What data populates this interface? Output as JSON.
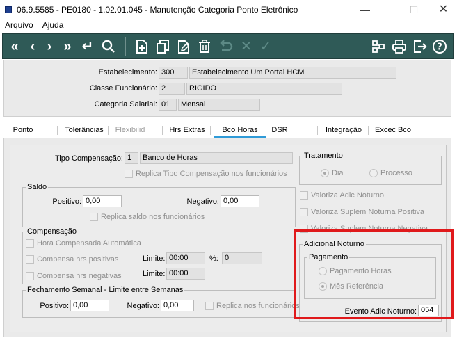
{
  "window": {
    "title": "06.9.5585 - PE0180 - 1.02.01.045 - Manutenção Categoria Ponto Eletrônico",
    "minimize": "—",
    "maximize": "☐",
    "close": "✕"
  },
  "menu": {
    "items": [
      {
        "label": "Arquivo"
      },
      {
        "label": "Ajuda"
      }
    ]
  },
  "toolbar": {
    "buttons": [
      {
        "icon": "first-record-icon",
        "glyph": "«"
      },
      {
        "icon": "previous-record-icon",
        "glyph": "‹"
      },
      {
        "icon": "next-record-icon",
        "glyph": "›"
      },
      {
        "icon": "last-record-icon",
        "glyph": "»"
      },
      {
        "icon": "goto-icon",
        "glyph": "↵"
      },
      {
        "icon": "search-icon",
        "glyph": "⌕"
      },
      {
        "icon": "add-icon",
        "glyph": ""
      },
      {
        "icon": "copy-icon",
        "glyph": ""
      },
      {
        "icon": "edit-icon",
        "glyph": ""
      },
      {
        "icon": "delete-icon",
        "glyph": ""
      },
      {
        "icon": "undo-icon",
        "glyph": ""
      },
      {
        "icon": "cancel-icon",
        "glyph": "✕"
      },
      {
        "icon": "confirm-icon",
        "glyph": "✓"
      },
      {
        "icon": "query-icon",
        "glyph": ""
      },
      {
        "icon": "print-icon",
        "glyph": ""
      },
      {
        "icon": "exit-icon",
        "glyph": ""
      },
      {
        "icon": "help-icon",
        "glyph": "?"
      }
    ]
  },
  "header": {
    "estabelecimento": {
      "label": "Estabelecimento:",
      "code": "300",
      "name": "Estabelecimento Um Portal HCM"
    },
    "classe": {
      "label": "Classe Funcionário:",
      "code": "2",
      "name": "RIGIDO"
    },
    "categoria": {
      "label": "Categoria Salarial:",
      "code": "01",
      "name": "Mensal"
    }
  },
  "tabs": [
    {
      "label": "Ponto",
      "state": "normal"
    },
    {
      "label": "Tolerâncias",
      "state": "normal"
    },
    {
      "label": "Flexibilid",
      "state": "disabled"
    },
    {
      "label": "Hrs Extras",
      "state": "normal"
    },
    {
      "label": "Bco Horas",
      "state": "active"
    },
    {
      "label": "DSR",
      "state": "normal"
    },
    {
      "label": "Integração",
      "state": "normal"
    },
    {
      "label": "Excec Bco",
      "state": "normal"
    }
  ],
  "bco_horas": {
    "tipo_compensacao": {
      "label": "Tipo Compensação:",
      "code": "1",
      "name": "Banco de Horas"
    },
    "replica_tipo": "Replica Tipo Compensação nos funcionários",
    "saldo": {
      "title": "Saldo",
      "positivo_label": "Positivo:",
      "positivo": "0,00",
      "negativo_label": "Negativo:",
      "negativo": "0,00",
      "replica": "Replica saldo nos funcionários"
    },
    "compensacao": {
      "title": "Compensação",
      "hora_auto": "Hora Compensada Automática",
      "hrs_positivas": "Compensa hrs positivas",
      "hrs_negativas": "Compensa hrs negativas",
      "limite_label": "Limite:",
      "limite1": "00:00",
      "pct_label": "%:",
      "pct": "0",
      "limite2": "00:00"
    },
    "fechamento": {
      "title": "Fechamento Semanal - Limite entre Semanas",
      "positivo_label": "Positivo:",
      "positivo": "0,00",
      "negativo_label": "Negativo:",
      "negativo": "0,00",
      "replica": "Replica nos funcionários"
    },
    "tratamento": {
      "title": "Tratamento",
      "dia": "Dia",
      "processo": "Processo"
    },
    "valoriza": {
      "adic_noturno": "Valoriza Adic Noturno",
      "suplem_positiva": "Valoriza Suplem Noturna Positiva",
      "suplem_negativa": "Valoriza Suplem Noturna Negativa"
    },
    "adicional_noturno": {
      "title": "Adicional Noturno",
      "pagamento_title": "Pagamento",
      "pagamento_horas": "Pagamento Horas",
      "mes_referencia": "Mês Referência",
      "evento_label": "Evento Adic Noturno:",
      "evento": "054"
    }
  },
  "colors": {
    "toolbar_bg": "#2f5a57",
    "active_tab": "#2f9bd8",
    "highlight": "#e0191b"
  }
}
